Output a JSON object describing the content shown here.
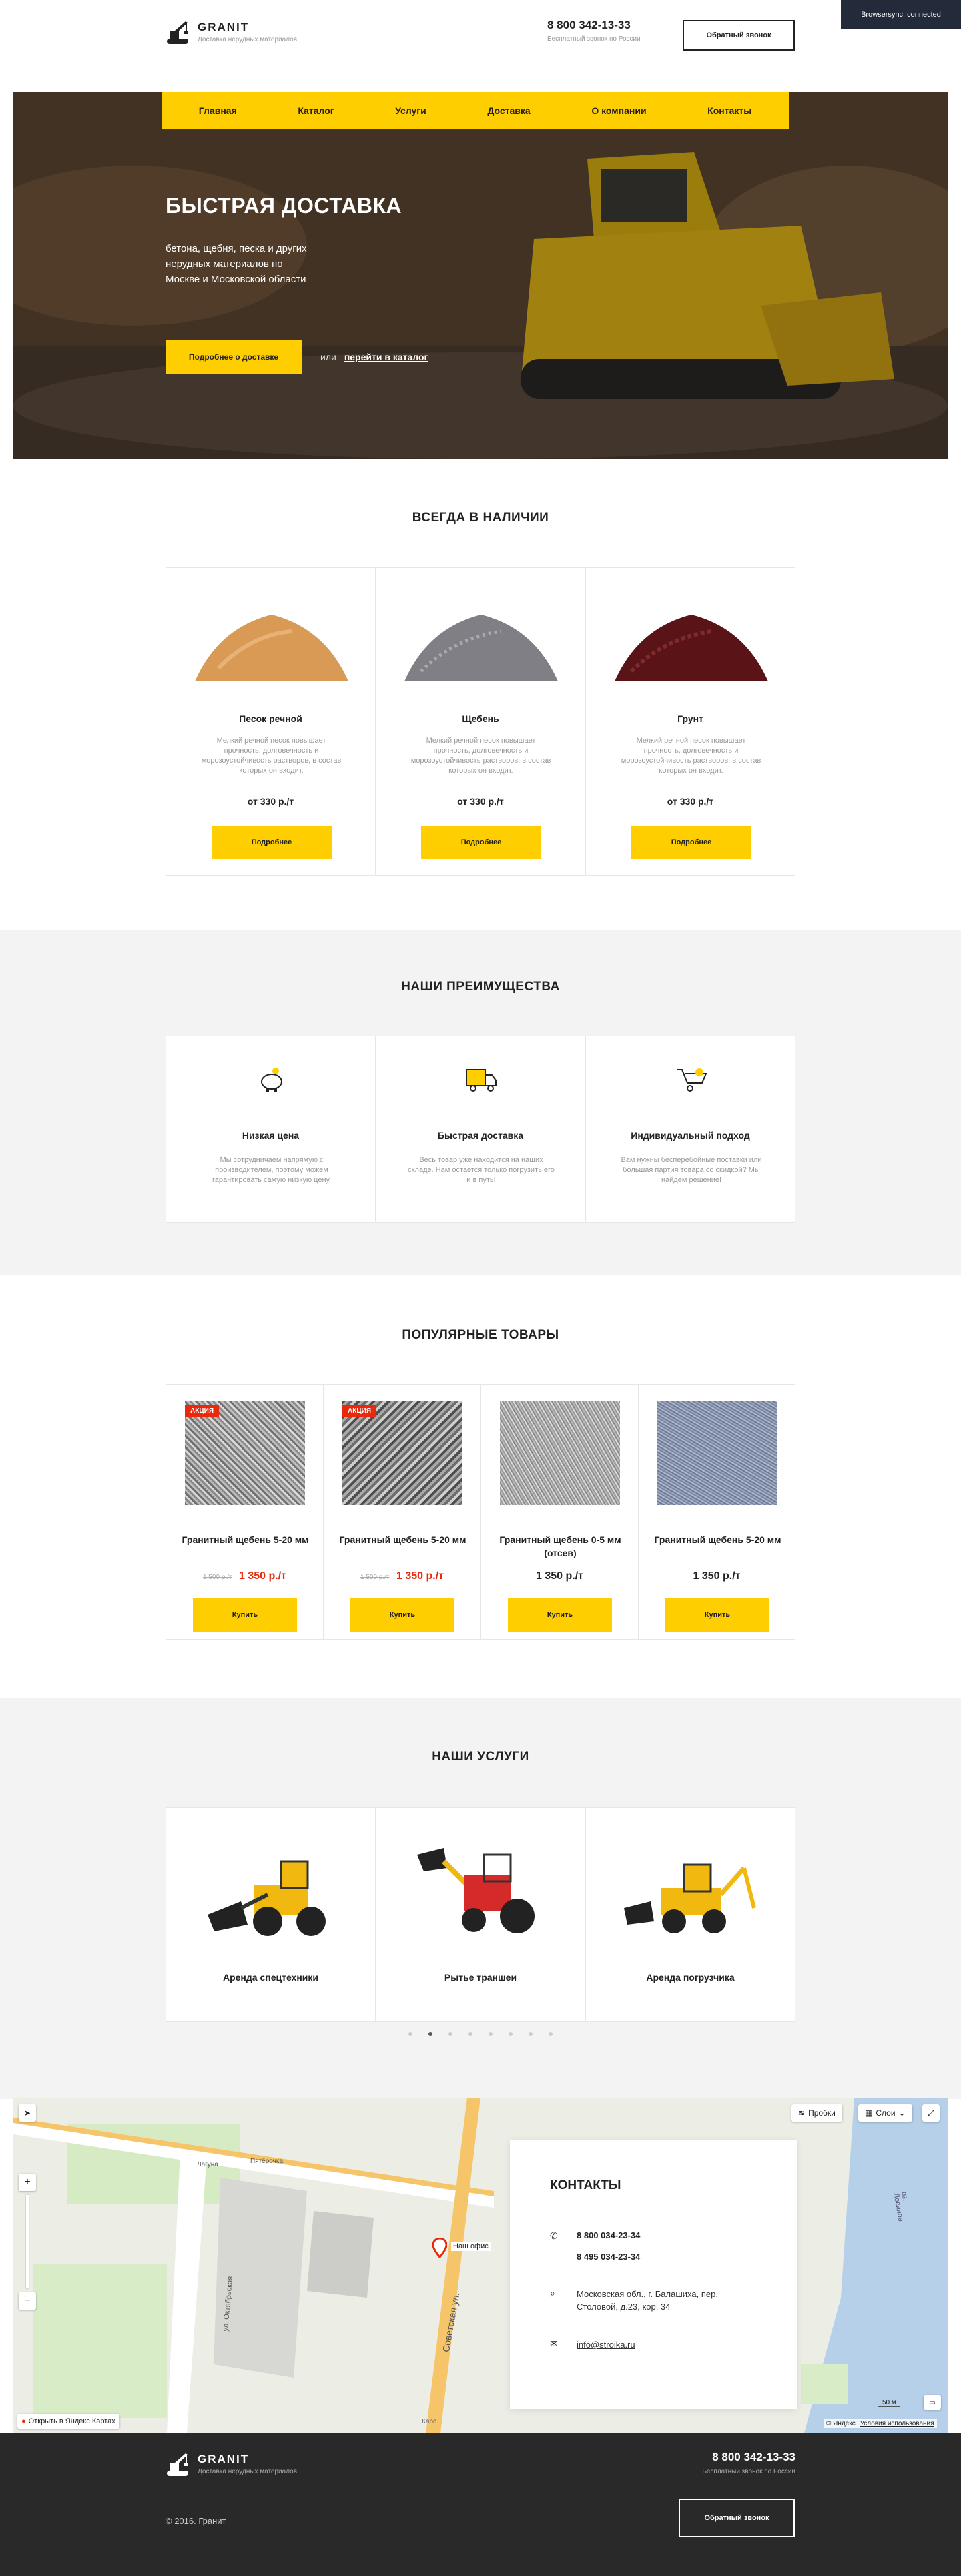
{
  "browsersync": "Browsersync: connected",
  "header": {
    "brand": "GRANIT",
    "tagline": "Доставка нерудных материалов",
    "phone": "8 800 342-13-33",
    "phone_note": "Бесплатный звонок по России",
    "callback": "Обратный звонок"
  },
  "nav": [
    "Главная",
    "Каталог",
    "Услуги",
    "Доставка",
    "О компании",
    "Контакты"
  ],
  "hero": {
    "title": "БЫСТРАЯ ДОСТАВКА",
    "text": [
      "бетона, щебня, песка и других",
      "нерудных материалов по",
      "Москве и Московской области"
    ],
    "button": "Подробнее о доставке",
    "or": "или",
    "link": "перейти в каталог"
  },
  "stock": {
    "title": "ВСЕГДА В НАЛИЧИИ",
    "items": [
      {
        "name": "Песок речной",
        "desc": "Мелкий речной песок повышает прочность, долговечность и морозоустойчивость растворов, в состав которых он входит.",
        "price": "от 330 р./т",
        "button": "Подробнее"
      },
      {
        "name": "Щебень",
        "desc": "Мелкий речной песок повышает прочность, долговечность и морозоустойчивость растворов, в состав которых он входит.",
        "price": "от 330 р./т",
        "button": "Подробнее"
      },
      {
        "name": "Грунт",
        "desc": "Мелкий речной песок повышает прочность, долговечность и морозоустойчивость растворов, в состав которых он входит.",
        "price": "от 330 р./т",
        "button": "Подробнее"
      }
    ]
  },
  "advantages": {
    "title": "НАШИ ПРЕИМУЩЕСТВА",
    "items": [
      {
        "name": "Низкая цена",
        "desc": "Мы сотрудничаем напрямую с производителем, поэтому можем гарантировать самую низкую цену."
      },
      {
        "name": "Быстрая доставка",
        "desc": "Весь товар уже находится на наших складе. Нам остается только погрузить его и в путь!"
      },
      {
        "name": "Индивидуальный подход",
        "desc": "Вам нужны бесперебойные поставки или большая партия товара со скидкой? Мы найдем решение!"
      }
    ]
  },
  "popular": {
    "title": "ПОПУЛЯРНЫЕ ТОВАРЫ",
    "badge": "АКЦИЯ",
    "buy": "Купить",
    "items": [
      {
        "name": "Гранитный щебень 5-20 мм",
        "old": "1 500 р./т",
        "price": "1 350 р./т",
        "sale": true
      },
      {
        "name": "Гранитный щебень 5-20 мм",
        "old": "1 500 р./т",
        "price": "1 350 р./т",
        "sale": true
      },
      {
        "name": "Гранитный щебень 0-5 мм (отсев)",
        "old": "",
        "price": "1 350 р./т",
        "sale": false
      },
      {
        "name": "Гранитный щебень 5-20 мм",
        "old": "",
        "price": "1 350 р./т",
        "sale": false
      }
    ]
  },
  "services": {
    "title": "НАШИ УСЛУГИ",
    "items": [
      "Аренда спецтехники",
      "Рытье траншеи",
      "Аренда погрузчика"
    ]
  },
  "map": {
    "traffic": "Пробки",
    "layers": "Слои",
    "office": "Наш офис",
    "open": "Открыть в Яндекс Картах",
    "scale": "50 м",
    "copy": "© Яндекс",
    "terms": "Условия использования",
    "street1": "Советская ул.",
    "street2": "ул. Октябрьская",
    "lake": "оз. Лосиное",
    "p1": "Лагуна",
    "p2": "Пятёрочка",
    "p3": "Карс"
  },
  "contacts": {
    "title": "КОНТАКТЫ",
    "phone1": "8 800 034-23-34",
    "phone2": "8 495 034-23-34",
    "address": "Московская обл., г. Балашиха, пер. Столовой, д.23, кор. 34",
    "email": "info@stroika.ru"
  },
  "footer": {
    "brand": "GRANIT",
    "tagline": "Доставка нерудных материалов",
    "phone": "8 800 342-13-33",
    "phone_note": "Бесплатный звонок по России",
    "copyright": "© 2016. Гранит",
    "callback": "Обратный звонок"
  },
  "colors": {
    "accent": "#ffce00",
    "sale": "#e8290b",
    "dark": "#292929",
    "gray_bg": "#f3f3f3"
  }
}
